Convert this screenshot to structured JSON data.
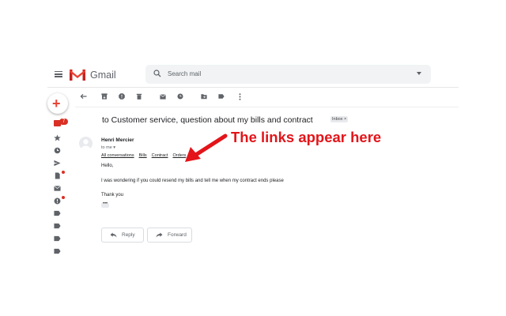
{
  "header": {
    "brand": "Gmail",
    "search_placeholder": "Search mail"
  },
  "left_rail": {
    "inbox_badge": "7"
  },
  "message": {
    "subject": "to Customer service, question about my bills and contract",
    "label_chip": "Inbox ×",
    "sender": "Henri Mercier",
    "to": "to me ▾",
    "links": [
      "All conversations",
      "Bills",
      "Contract",
      "Orders"
    ],
    "greeting": "Hello,",
    "body": "I was wondering if you could resend my bills and tell me when my contract ends please",
    "signoff": "Thank you",
    "ellipsis": "•••"
  },
  "actions": {
    "reply_label": "Reply",
    "forward_label": "Forward"
  },
  "annotation": {
    "text": "The links appear here",
    "color": "#e3151a"
  },
  "colors": {
    "accent_red": "#d93025",
    "search_bg": "#f1f3f4"
  }
}
